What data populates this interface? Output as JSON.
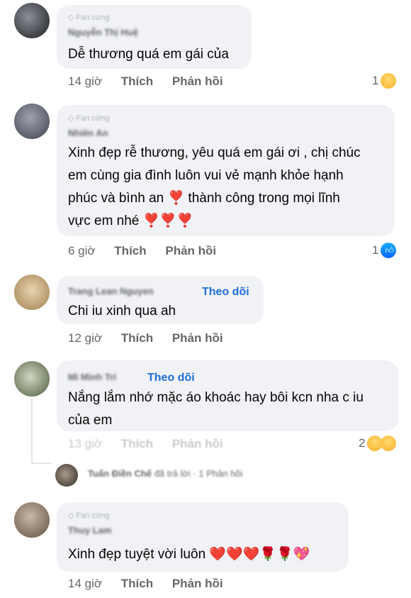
{
  "comments": [
    {
      "badge": "Fan cứng",
      "author": "Nguyễn Thị Huệ",
      "text": "Dễ thương quá em gái của",
      "time": "14 giờ",
      "like_label": "Thích",
      "reply_label": "Phản hồi",
      "reaction_count": "1",
      "reaction_icon": "care-face-icon"
    },
    {
      "badge": "Fan cứng",
      "author": "Nhiên An",
      "text_lines": [
        "Xinh đẹp rễ thương, yêu quá em gái ơi , chị chúc",
        "em cùng gia đình luôn vui vẻ mạnh khỏe hạnh",
        "phúc và bình an ❣️ thành công trong mọi lĩnh",
        "vực em nhé ❣️❣️❣️"
      ],
      "time": "6 giờ",
      "like_label": "Thích",
      "reply_label": "Phản hồi",
      "reaction_count": "1",
      "reaction_icon": "like-thumb-icon"
    },
    {
      "author": "Trang Lean Nguyen",
      "follow_label": "Theo dõi",
      "text": "Chi iu xinh qua ah",
      "time": "12 giờ",
      "like_label": "Thích",
      "reply_label": "Phản hồi"
    },
    {
      "author": "Mì Minh Trí",
      "follow_label": "Theo dõi",
      "text_lines": [
        "Nắng lắm nhớ mặc áo khoác hay bôi kcn nha c iu",
        "của em"
      ],
      "time": "13 giờ",
      "like_label": "Thích",
      "reply_label": "Phản hồi",
      "reaction_count": "2",
      "reaction_icons": [
        "care-face-icon",
        "haha-face-icon"
      ]
    },
    {
      "badge": "Fan cứng",
      "author": "Thuy Lam",
      "text": "Xinh đẹp tuyệt vời luôn ❤️❤️❤️🌹🌹💖",
      "time": "14 giờ",
      "like_label": "Thích",
      "reply_label": "Phản hồi"
    }
  ],
  "reply_preview": {
    "author": "Tuấn Điền Chế",
    "meta": "đã trả lời · 1 Phản hồi"
  },
  "colors": {
    "bubble": "#f0f2f5",
    "follow": "#216fdb",
    "meta": "#65676b"
  }
}
